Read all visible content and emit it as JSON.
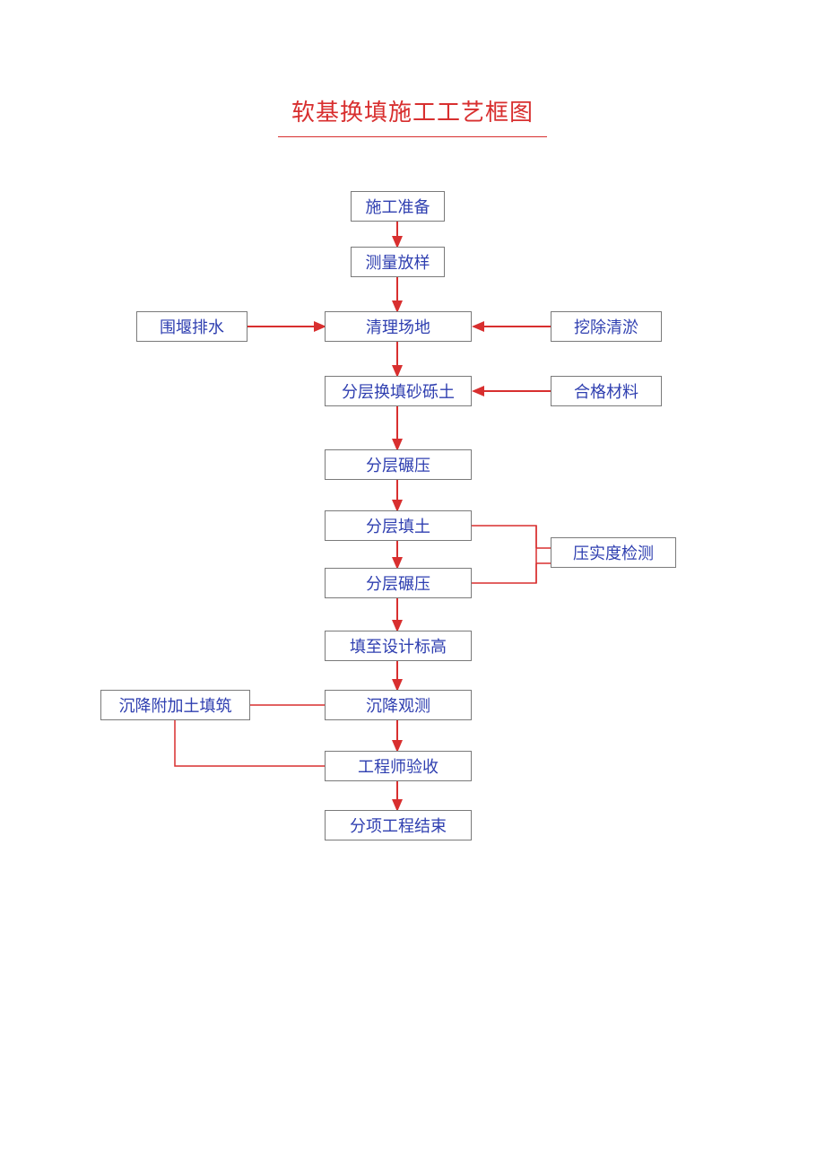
{
  "title": "软基换填施工工艺框图",
  "boxes": {
    "b1": "施工准备",
    "b2": "测量放样",
    "b3": "清理场地",
    "b3l": "围堰排水",
    "b3r": "挖除清淤",
    "b4": "分层换填砂砾土",
    "b4r": "合格材料",
    "b5": "分层碾压",
    "b6": "分层填土",
    "b7": "分层碾压",
    "b67r": "压实度检测",
    "b8": "填至设计标高",
    "b9": "沉降观测",
    "b9l": "沉降附加土填筑",
    "b10": "工程师验收",
    "b11": "分项工程结束"
  },
  "chart_data": {
    "type": "flowchart",
    "nodes": [
      {
        "id": "b1",
        "label": "施工准备"
      },
      {
        "id": "b2",
        "label": "测量放样"
      },
      {
        "id": "b3",
        "label": "清理场地"
      },
      {
        "id": "b3l",
        "label": "围堰排水"
      },
      {
        "id": "b3r",
        "label": "挖除清淤"
      },
      {
        "id": "b4",
        "label": "分层换填砂砾土"
      },
      {
        "id": "b4r",
        "label": "合格材料"
      },
      {
        "id": "b5",
        "label": "分层碾压"
      },
      {
        "id": "b6",
        "label": "分层填土"
      },
      {
        "id": "b7",
        "label": "分层碾压"
      },
      {
        "id": "b67r",
        "label": "压实度检测"
      },
      {
        "id": "b8",
        "label": "填至设计标高"
      },
      {
        "id": "b9",
        "label": "沉降观测"
      },
      {
        "id": "b9l",
        "label": "沉降附加土填筑"
      },
      {
        "id": "b10",
        "label": "工程师验收"
      },
      {
        "id": "b11",
        "label": "分项工程结束"
      }
    ],
    "edges": [
      {
        "from": "b1",
        "to": "b2"
      },
      {
        "from": "b2",
        "to": "b3"
      },
      {
        "from": "b3l",
        "to": "b3"
      },
      {
        "from": "b3r",
        "to": "b3"
      },
      {
        "from": "b3",
        "to": "b4"
      },
      {
        "from": "b4r",
        "to": "b4"
      },
      {
        "from": "b4",
        "to": "b5"
      },
      {
        "from": "b5",
        "to": "b6"
      },
      {
        "from": "b6",
        "to": "b7"
      },
      {
        "from": "b67r",
        "to": "b6"
      },
      {
        "from": "b7",
        "to": "b67r"
      },
      {
        "from": "b7",
        "to": "b8"
      },
      {
        "from": "b8",
        "to": "b9"
      },
      {
        "from": "b9",
        "to": "b9l"
      },
      {
        "from": "b9l",
        "to": "b10"
      },
      {
        "from": "b9",
        "to": "b10"
      },
      {
        "from": "b10",
        "to": "b11"
      }
    ]
  }
}
